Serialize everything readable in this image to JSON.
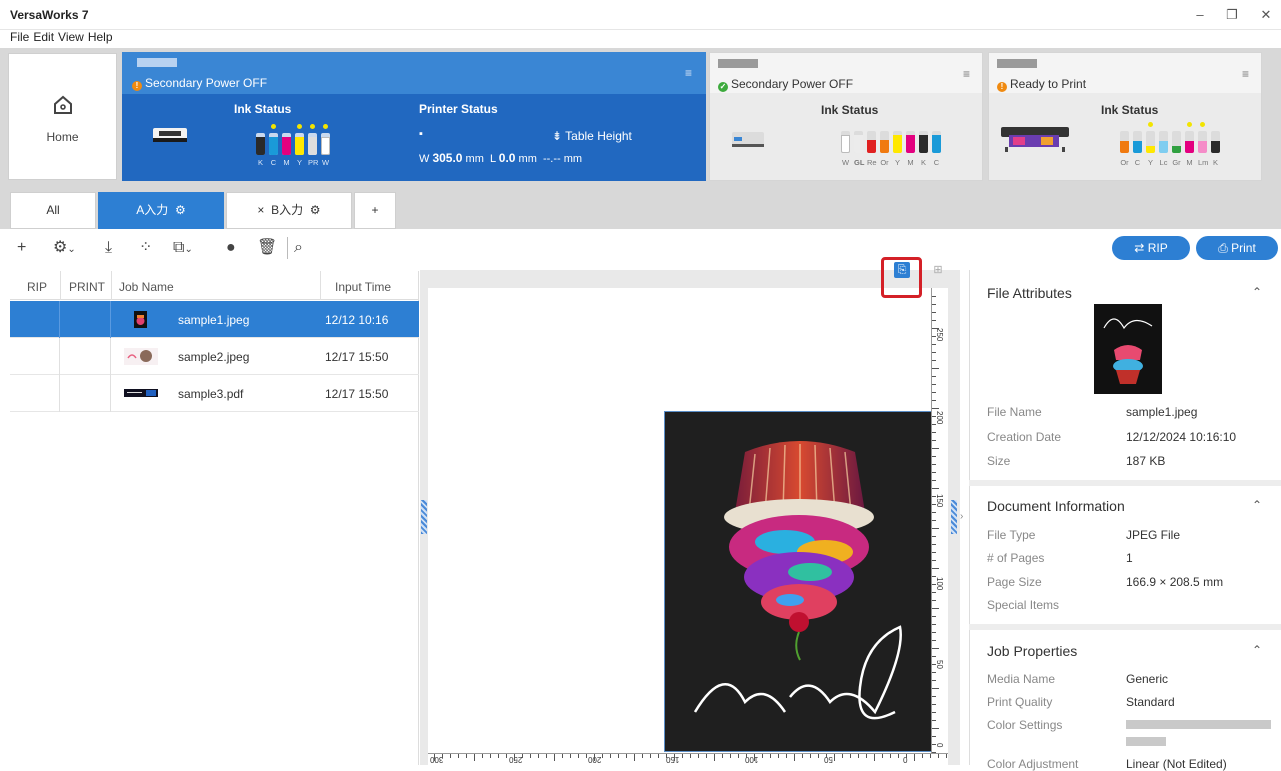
{
  "app": {
    "title": "VersaWorks 7"
  },
  "window_controls": {
    "minimize": "–",
    "maximize": "❐",
    "close": "✕"
  },
  "menu": [
    "File",
    "Edit",
    "View",
    "Help"
  ],
  "home": {
    "label": "Home",
    "icon": "home-icon"
  },
  "printers": [
    {
      "status": "Secondary Power OFF",
      "status_color": "#f08a10",
      "ink_title": "Ink Status",
      "inks": [
        {
          "label": "K",
          "color": "#2a2a2a",
          "level": 0.82,
          "dot": false
        },
        {
          "label": "C",
          "color": "#1a9ad8",
          "level": 0.82,
          "dot": true
        },
        {
          "label": "M",
          "color": "#e3007f",
          "level": 0.82,
          "dot": false
        },
        {
          "label": "Y",
          "color": "#ffe800",
          "level": 0.82,
          "dot": true
        },
        {
          "label": "PR",
          "color": "#dddddd",
          "level": 0.82,
          "dot": true
        },
        {
          "label": "W",
          "color": "#ffffff",
          "level": 0.82,
          "dot": true
        }
      ],
      "printer_status_title": "Printer Status",
      "table_height_label": "Table Height",
      "w_label": "W",
      "w_value": "305.0",
      "w_unit": "mm",
      "l_label": "L",
      "l_value": "0.0",
      "l_unit": "mm",
      "height_value": "--.-- mm"
    },
    {
      "status": "Secondary Power OFF",
      "status_color": "#3daa3d",
      "ink_title": "Ink Status",
      "inks": [
        {
          "label": "W",
          "color": "#ffffff",
          "level": 0.8,
          "dot": false
        },
        {
          "label": "GL",
          "color": "#ececec",
          "level": 0.8,
          "dot": false
        },
        {
          "label": "Re",
          "color": "#e02020",
          "level": 0.6,
          "dot": false
        },
        {
          "label": "Or",
          "color": "#f07a10",
          "level": 0.6,
          "dot": false
        },
        {
          "label": "Y",
          "color": "#ffe800",
          "level": 0.8,
          "dot": false
        },
        {
          "label": "M",
          "color": "#e3007f",
          "level": 0.8,
          "dot": false
        },
        {
          "label": "K",
          "color": "#2a2a2a",
          "level": 0.8,
          "dot": false
        },
        {
          "label": "C",
          "color": "#1a9ad8",
          "level": 0.8,
          "dot": false
        }
      ]
    },
    {
      "status": "Ready to Print",
      "status_color": "#f08a10",
      "ink_title": "Ink Status",
      "inks": [
        {
          "label": "Or",
          "color": "#f07a10",
          "level": 0.55,
          "dot": false
        },
        {
          "label": "C",
          "color": "#1a9ad8",
          "level": 0.55,
          "dot": false
        },
        {
          "label": "Y",
          "color": "#ffe800",
          "level": 0.3,
          "dot": true
        },
        {
          "label": "Lc",
          "color": "#7fcdf0",
          "level": 0.55,
          "dot": false
        },
        {
          "label": "Gr",
          "color": "#30a040",
          "level": 0.3,
          "dot": false
        },
        {
          "label": "M",
          "color": "#e3007f",
          "level": 0.55,
          "dot": true
        },
        {
          "label": "Lm",
          "color": "#f58cc8",
          "level": 0.55,
          "dot": true
        },
        {
          "label": "K",
          "color": "#2a2a2a",
          "level": 0.55,
          "dot": false
        }
      ]
    }
  ],
  "queue_tabs": {
    "all": "All",
    "a": "A入力",
    "b": "B入力",
    "add": "+",
    "close": "×"
  },
  "toolbar": {
    "rip": "RIP",
    "print": "Print"
  },
  "job_list": {
    "headers": [
      "RIP",
      "PRINT",
      "Job Name",
      "Input Time"
    ],
    "rows": [
      {
        "name": "sample1.jpeg",
        "time": "12/12 10:16",
        "selected": true
      },
      {
        "name": "sample2.jpeg",
        "time": "12/17 15:50",
        "selected": false
      },
      {
        "name": "sample3.pdf",
        "time": "12/17 15:50",
        "selected": false
      }
    ]
  },
  "preview": {
    "ruler_v": [
      "250",
      "200",
      "150",
      "100",
      "50",
      "0"
    ],
    "ruler_h": [
      "300",
      "250",
      "200",
      "150",
      "100",
      "50",
      "0"
    ]
  },
  "file_attributes": {
    "title": "File Attributes",
    "file_name_label": "File Name",
    "file_name": "sample1.jpeg",
    "creation_label": "Creation Date",
    "creation": "12/12/2024 10:16:10",
    "size_label": "Size",
    "size": "187 KB"
  },
  "document_info": {
    "title": "Document Information",
    "file_type_label": "File Type",
    "file_type": "JPEG File",
    "pages_label": "# of Pages",
    "pages": "1",
    "page_size_label": "Page Size",
    "page_size": "166.9 × 208.5 mm",
    "special_label": "Special Items"
  },
  "job_properties": {
    "title": "Job Properties",
    "media_label": "Media Name",
    "media": "Generic",
    "quality_label": "Print Quality",
    "quality": "Standard",
    "color_label": "Color Settings",
    "adjust_label": "Color Adjustment",
    "adjust": "Linear (Not Edited)"
  }
}
